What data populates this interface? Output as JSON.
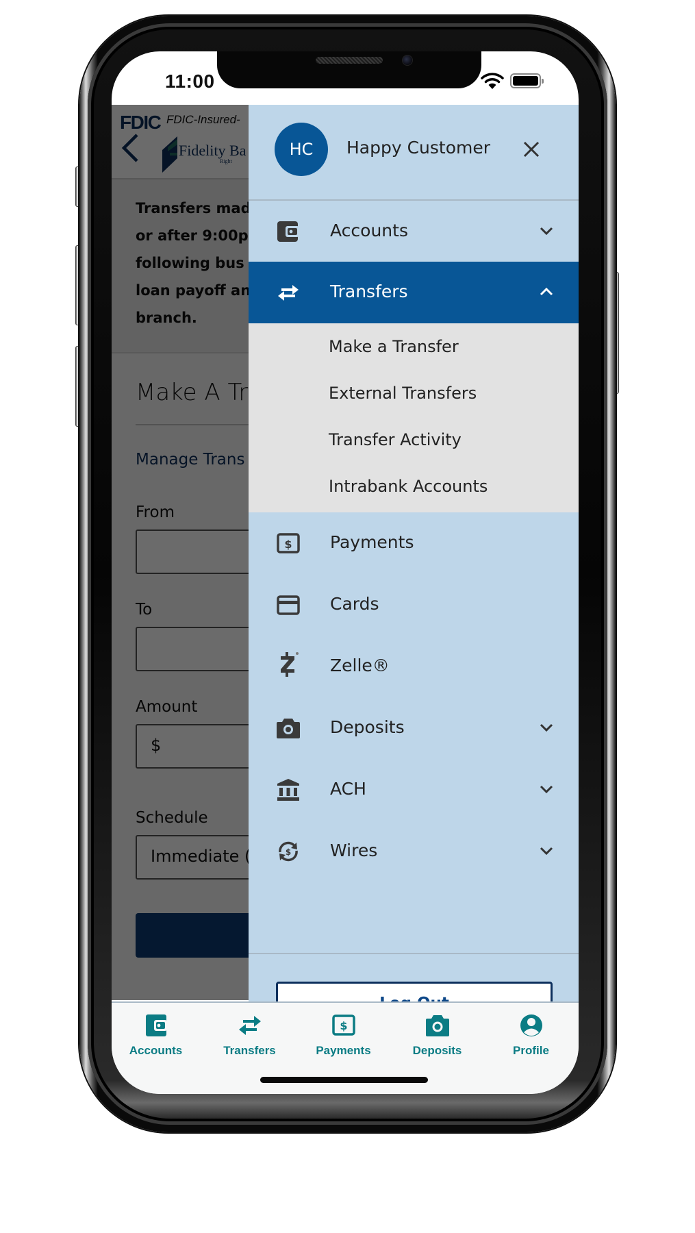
{
  "status_bar": {
    "time": "11:00",
    "wifi_icon": "wifi-icon",
    "battery_icon": "battery-full-icon"
  },
  "base_page": {
    "fdic_badge": "FDIC",
    "fdic_text": "FDIC-Insured-",
    "back_icon": "chevron-left-icon",
    "bank_name": "Fidelity Ba",
    "bank_tagline": "Right",
    "notice_text": "Transfers mad or after 9:00p following bus loan payoff an branch.",
    "notice_lines": [
      "Transfers mad",
      "or after 9:00p",
      "following bus",
      "loan payoff an",
      "branch."
    ],
    "form_title": "Make A Tr",
    "manage_link": "Manage Trans",
    "fields": [
      {
        "label": "From",
        "value": ""
      },
      {
        "label": "To",
        "value": ""
      },
      {
        "label": "Amount",
        "value": "$"
      },
      {
        "label": "Schedule",
        "value": "Immediate (("
      }
    ]
  },
  "drawer": {
    "user": {
      "initials": "HC",
      "name": "Happy Customer"
    },
    "close_icon": "close-icon",
    "items": [
      {
        "label": "Accounts",
        "icon": "wallet-icon",
        "expandable": true,
        "expanded": false
      },
      {
        "label": "Transfers",
        "icon": "transfer-arrows-icon",
        "expandable": true,
        "expanded": true,
        "active": true,
        "children": [
          "Make a Transfer",
          "External Transfers",
          "Transfer Activity",
          "Intrabank Accounts"
        ]
      },
      {
        "label": "Payments",
        "icon": "dollar-bill-icon",
        "expandable": false
      },
      {
        "label": "Cards",
        "icon": "credit-card-icon",
        "expandable": false
      },
      {
        "label": "Zelle®",
        "icon": "zelle-icon",
        "expandable": false
      },
      {
        "label": "Deposits",
        "icon": "camera-icon",
        "expandable": true,
        "expanded": false
      },
      {
        "label": "ACH",
        "icon": "bank-icon",
        "expandable": true,
        "expanded": false
      },
      {
        "label": "Wires",
        "icon": "wire-transfer-icon",
        "expandable": true,
        "expanded": false
      }
    ],
    "logout_label": "Log Out"
  },
  "bottom_nav": [
    {
      "label": "Accounts",
      "icon": "wallet-icon"
    },
    {
      "label": "Transfers",
      "icon": "transfer-arrows-icon"
    },
    {
      "label": "Payments",
      "icon": "dollar-bill-icon"
    },
    {
      "label": "Deposits",
      "icon": "camera-icon"
    },
    {
      "label": "Profile",
      "icon": "user-circle-icon"
    }
  ],
  "colors": {
    "drawer_bg": "#bed6e9",
    "active_item_bg": "#085696",
    "submenu_bg": "#e2e2e2",
    "avatar_bg": "#085696",
    "nav_accent": "#0b7c84",
    "logout_text": "#0d4788",
    "brand_navy": "#0d2f5c"
  }
}
